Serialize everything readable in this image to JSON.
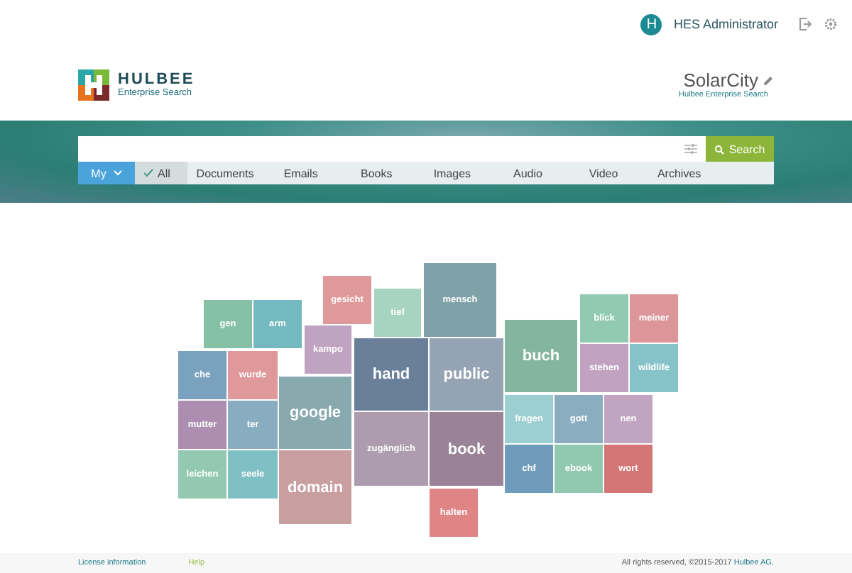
{
  "user": {
    "initial": "H",
    "name": "HES Administrator"
  },
  "logo": {
    "name": "HULBEE",
    "subtitle": "Enterprise Search"
  },
  "workspace": {
    "title": "SolarCity",
    "subtitle": "Hulbee Enterprise Search"
  },
  "search": {
    "button": "Search",
    "scope": "My"
  },
  "filters": [
    {
      "label": "All",
      "selected": true
    },
    {
      "label": "Documents",
      "selected": false
    },
    {
      "label": "Emails",
      "selected": false
    },
    {
      "label": "Books",
      "selected": false
    },
    {
      "label": "Images",
      "selected": false
    },
    {
      "label": "Audio",
      "selected": false
    },
    {
      "label": "Video",
      "selected": false
    },
    {
      "label": "Archives",
      "selected": false
    }
  ],
  "cloud": [
    {
      "word": "gen",
      "color": "#86c1a6"
    },
    {
      "word": "arm",
      "color": "#74b8c0"
    },
    {
      "word": "gesicht",
      "color": "#e0999a"
    },
    {
      "word": "tief",
      "color": "#a6d4c1"
    },
    {
      "word": "mensch",
      "color": "#7fa2a8"
    },
    {
      "word": "kampo",
      "color": "#c0a3c0"
    },
    {
      "word": "hand",
      "color": "#6a7f99"
    },
    {
      "word": "public",
      "color": "#94a4b4"
    },
    {
      "word": "buch",
      "color": "#84b59f"
    },
    {
      "word": "blick",
      "color": "#92cab1"
    },
    {
      "word": "meiner",
      "color": "#dc9598"
    },
    {
      "word": "stehen",
      "color": "#c1a3c1"
    },
    {
      "word": "wildlife",
      "color": "#86c3c9"
    },
    {
      "word": "che",
      "color": "#7aa1bd"
    },
    {
      "word": "wurde",
      "color": "#e0999a"
    },
    {
      "word": "mutter",
      "color": "#ad8eb0"
    },
    {
      "word": "ter",
      "color": "#88acc0"
    },
    {
      "word": "leichen",
      "color": "#92c9b0"
    },
    {
      "word": "seele",
      "color": "#7fc0c4"
    },
    {
      "word": "google",
      "color": "#88a9ae"
    },
    {
      "word": "domain",
      "color": "#c99e9f"
    },
    {
      "word": "zugänglich",
      "color": "#ac9cad"
    },
    {
      "word": "book",
      "color": "#9a8297"
    },
    {
      "word": "fragen",
      "color": "#9ccfd1"
    },
    {
      "word": "gott",
      "color": "#8badc0"
    },
    {
      "word": "nen",
      "color": "#c0a4c0"
    },
    {
      "word": "chf",
      "color": "#6e9cba"
    },
    {
      "word": "ebook",
      "color": "#90c8b0"
    },
    {
      "word": "wort",
      "color": "#d57676"
    },
    {
      "word": "halten",
      "color": "#df8585"
    }
  ],
  "footer": {
    "license": "License information",
    "help": "Help",
    "copyright": "All rights reserved, ©2015-2017",
    "company": "Hulbee AG."
  }
}
